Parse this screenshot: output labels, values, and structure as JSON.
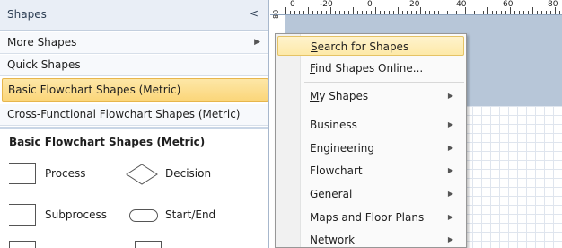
{
  "pane": {
    "title": "Shapes",
    "collapse_glyph": "<",
    "rows": {
      "more": "More Shapes",
      "quick": "Quick Shapes",
      "basic": "Basic Flowchart Shapes (Metric)",
      "cross": "Cross-Functional Flowchart Shapes (Metric)"
    },
    "submenu_glyph": "▶",
    "stencil_title": "Basic Flowchart Shapes (Metric)",
    "shapes": {
      "process": "Process",
      "decision": "Decision",
      "subprocess": "Subprocess",
      "startend": "Start/End"
    }
  },
  "ruler": {
    "top_labels": [
      "0",
      "-20",
      "0",
      "20",
      "40",
      "60",
      "80"
    ],
    "left_label": "80"
  },
  "menu": {
    "search_prefix": "S",
    "search_rest": "earch for Shapes",
    "find_prefix": "F",
    "find_rest": "ind Shapes Online...",
    "my_prefix": "M",
    "my_rest": "y Shapes",
    "categories": [
      "Business",
      "Engineering",
      "Flowchart",
      "General",
      "Maps and Floor Plans",
      "Network"
    ],
    "submenu_glyph": "▶"
  },
  "colors": {
    "selection_fill": "#fbd67a",
    "menu_highlight": "#fde9a8",
    "canvas_bg": "#b7c6d8"
  }
}
